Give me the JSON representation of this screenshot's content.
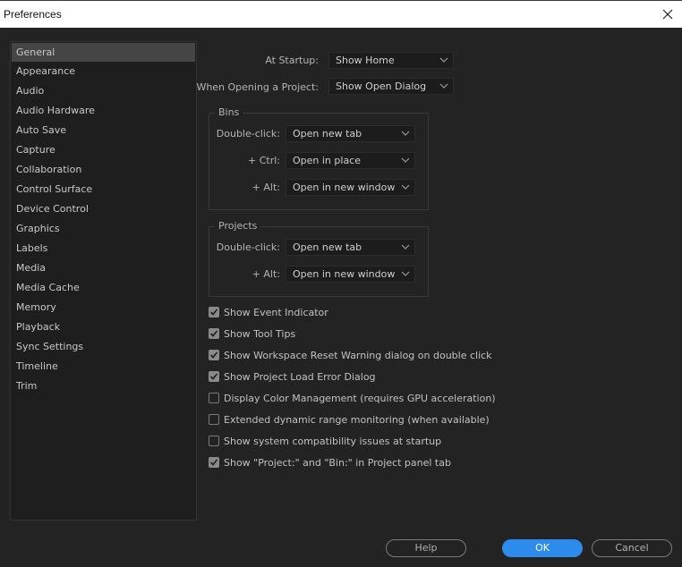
{
  "window": {
    "title": "Preferences",
    "close_icon": "close-icon"
  },
  "sidebar": {
    "selected": "General",
    "items": [
      {
        "label": "General"
      },
      {
        "label": "Appearance"
      },
      {
        "label": "Audio"
      },
      {
        "label": "Audio Hardware"
      },
      {
        "label": "Auto Save"
      },
      {
        "label": "Capture"
      },
      {
        "label": "Collaboration"
      },
      {
        "label": "Control Surface"
      },
      {
        "label": "Device Control"
      },
      {
        "label": "Graphics"
      },
      {
        "label": "Labels"
      },
      {
        "label": "Media"
      },
      {
        "label": "Media Cache"
      },
      {
        "label": "Memory"
      },
      {
        "label": "Playback"
      },
      {
        "label": "Sync Settings"
      },
      {
        "label": "Timeline"
      },
      {
        "label": "Trim"
      }
    ]
  },
  "general": {
    "at_startup": {
      "label": "At Startup:",
      "value": "Show Home"
    },
    "when_opening": {
      "label": "When Opening a Project:",
      "value": "Show Open Dialog"
    },
    "bins": {
      "title": "Bins",
      "double_click": {
        "label": "Double-click:",
        "value": "Open new tab"
      },
      "ctrl": {
        "label": "+ Ctrl:",
        "value": "Open in place"
      },
      "alt": {
        "label": "+ Alt:",
        "value": "Open in new window"
      }
    },
    "projects": {
      "title": "Projects",
      "double_click": {
        "label": "Double-click:",
        "value": "Open new tab"
      },
      "alt": {
        "label": "+ Alt:",
        "value": "Open in new window"
      }
    },
    "checkboxes": [
      {
        "label": "Show Event Indicator",
        "checked": true
      },
      {
        "label": "Show Tool Tips",
        "checked": true
      },
      {
        "label": "Show Workspace Reset Warning dialog on double click",
        "checked": true
      },
      {
        "label": "Show Project Load Error Dialog",
        "checked": true
      },
      {
        "label": "Display Color Management (requires GPU acceleration)",
        "checked": false
      },
      {
        "label": "Extended dynamic range monitoring (when available)",
        "checked": false
      },
      {
        "label": "Show system compatibility issues at startup",
        "checked": false
      },
      {
        "label": "Show \"Project:\" and \"Bin:\" in Project panel tab",
        "checked": true
      }
    ]
  },
  "footer": {
    "help": "Help",
    "ok": "OK",
    "cancel": "Cancel"
  },
  "colors": {
    "accent": "#2d8ceb",
    "background": "#232323",
    "panel": "#1e1e1e",
    "selected": "#454545"
  }
}
